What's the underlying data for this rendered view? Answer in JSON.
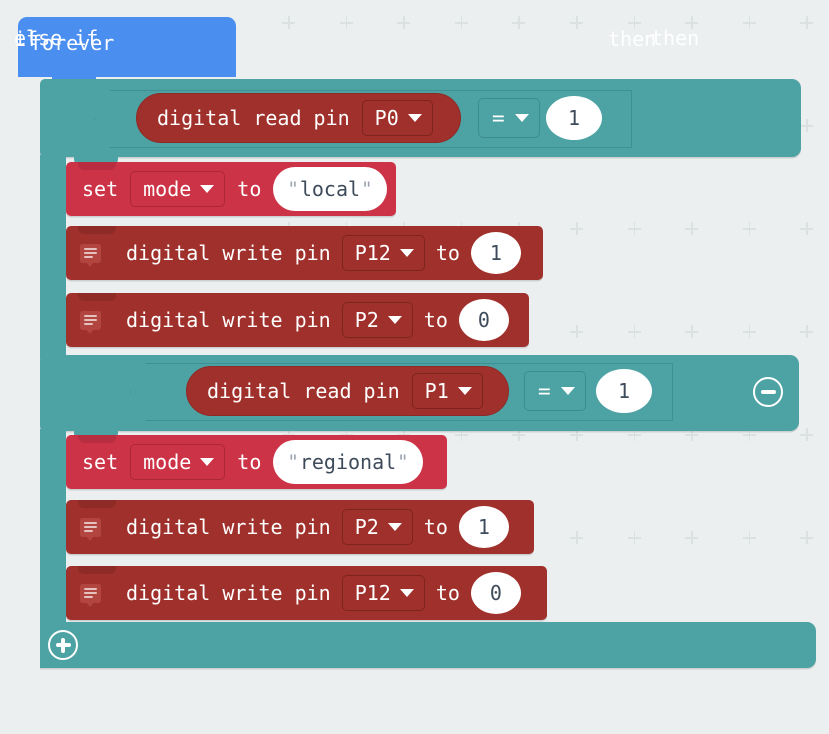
{
  "workspace": {
    "background_color": "#ECEFF0",
    "grid_mark_color": "#DBE0E1",
    "grid_spacing_px": 57.6,
    "grid_mark": "plus-grid-mark"
  },
  "palette": {
    "loops_blue": "#4A8EF0",
    "logic_teal": "#4DA2A4",
    "variables_crimson": "#CD3347",
    "pins_dark_red": "#A0302B",
    "field_white": "#FFFFFF",
    "field_text_navy": "#3E4B5B",
    "quote_gray": "#9AA4B0"
  },
  "program": {
    "forever": {
      "label": "forever"
    },
    "if_block": {
      "if_label": "if",
      "then_label": "then",
      "condition": {
        "left": {
          "block": "digital read pin",
          "label": "digital read pin",
          "pin": "P0"
        },
        "operator": "=",
        "right": "1"
      },
      "body": [
        {
          "type": "set-variable",
          "set_label": "set",
          "variable": "mode",
          "to_label": "to",
          "value_quote_open": "\"",
          "value": "local",
          "value_quote_close": "\""
        },
        {
          "type": "digital-write",
          "has_comment_icon": true,
          "label": "digital write pin",
          "pin": "P12",
          "to_label": "to",
          "value": "1"
        },
        {
          "type": "digital-write",
          "has_comment_icon": true,
          "label": "digital write pin",
          "pin": "P2",
          "to_label": "to",
          "value": "0"
        }
      ]
    },
    "else_if_block": {
      "else_if_label": "else if",
      "then_label": "then",
      "remove_button": "minus-mutator-button",
      "condition": {
        "left": {
          "block": "digital read pin",
          "label": "digital read pin",
          "pin": "P1"
        },
        "operator": "=",
        "right": "1"
      },
      "body": [
        {
          "type": "set-variable",
          "set_label": "set",
          "variable": "mode",
          "to_label": "to",
          "value_quote_open": "\"",
          "value": "regional",
          "value_quote_close": "\""
        },
        {
          "type": "digital-write",
          "has_comment_icon": true,
          "label": "digital write pin",
          "pin": "P2",
          "to_label": "to",
          "value": "1"
        },
        {
          "type": "digital-write",
          "has_comment_icon": true,
          "label": "digital write pin",
          "pin": "P12",
          "to_label": "to",
          "value": "0"
        }
      ]
    },
    "add_branch_button": "plus-mutator-button"
  }
}
